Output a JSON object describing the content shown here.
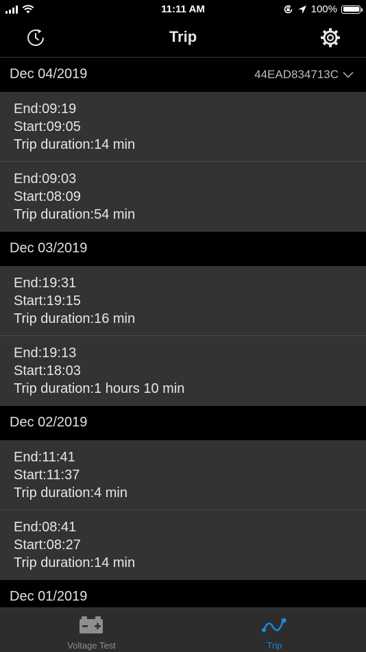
{
  "status_bar": {
    "time": "11:11 AM",
    "battery": "100%",
    "battery_level": 1.0,
    "icons": [
      "signal-icon",
      "wifi-icon",
      "lock-rotation-icon",
      "location-arrow-icon",
      "battery-icon"
    ]
  },
  "header": {
    "title": "Trip",
    "left_icon": "history-icon",
    "right_icon": "gear-icon"
  },
  "device_id": "44EAD834713C",
  "sections": [
    {
      "date": "Dec 04/2019",
      "trips": [
        {
          "end": "End:09:19",
          "start": "Start:09:05",
          "duration": "Trip duration:14 min"
        },
        {
          "end": "End:09:03",
          "start": "Start:08:09",
          "duration": "Trip duration:54 min"
        }
      ]
    },
    {
      "date": "Dec 03/2019",
      "trips": [
        {
          "end": "End:19:31",
          "start": "Start:19:15",
          "duration": "Trip duration:16 min"
        },
        {
          "end": "End:19:13",
          "start": "Start:18:03",
          "duration": "Trip duration:1 hours 10 min"
        }
      ]
    },
    {
      "date": "Dec 02/2019",
      "trips": [
        {
          "end": "End:11:41",
          "start": "Start:11:37",
          "duration": "Trip duration:4 min"
        },
        {
          "end": "End:08:41",
          "start": "Start:08:27",
          "duration": "Trip duration:14 min"
        }
      ]
    },
    {
      "date": "Dec 01/2019",
      "trips": []
    }
  ],
  "tabs": [
    {
      "label": "Voltage Test",
      "icon": "battery-car-icon",
      "active": false
    },
    {
      "label": "Trip",
      "icon": "route-icon",
      "active": true
    }
  ],
  "colors": {
    "accent": "#1e88d6",
    "inactive_tab": "#8e8e8e",
    "row_bg": "#333333",
    "header_bg": "#000000"
  }
}
